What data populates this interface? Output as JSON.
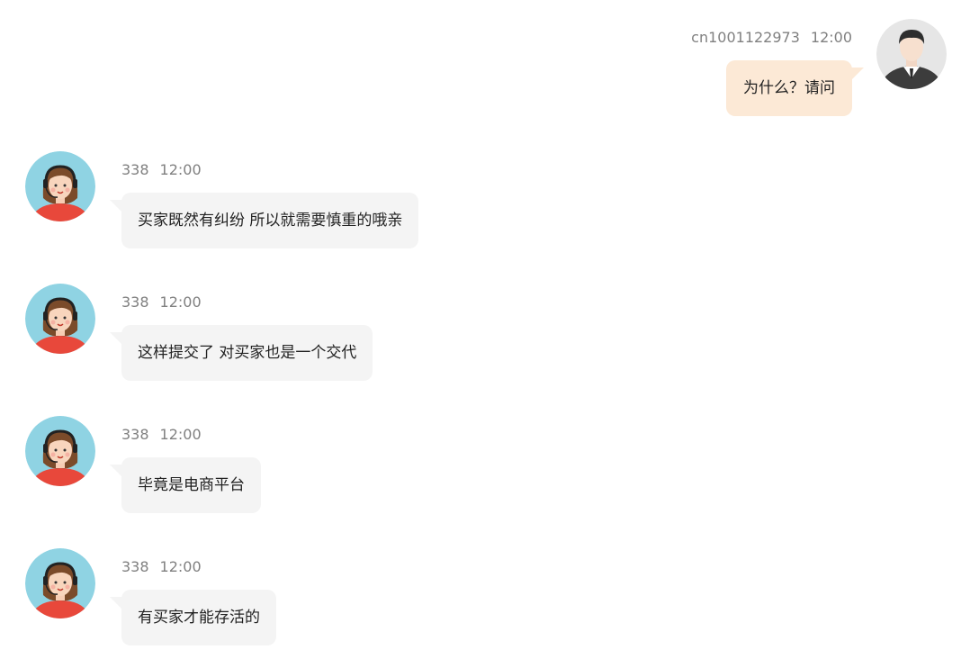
{
  "conversation": {
    "outgoing": {
      "sender": "cn1001122973",
      "time": "12:00",
      "text": "为什么？请问",
      "avatar_icon": "businessman-avatar-icon"
    },
    "incoming": [
      {
        "sender": "338",
        "time": "12:00",
        "text": "买家既然有纠纷 所以就需要慎重的哦亲",
        "avatar_icon": "agent-headset-avatar-icon"
      },
      {
        "sender": "338",
        "time": "12:00",
        "text": "这样提交了 对买家也是一个交代",
        "avatar_icon": "agent-headset-avatar-icon"
      },
      {
        "sender": "338",
        "time": "12:00",
        "text": "毕竟是电商平台",
        "avatar_icon": "agent-headset-avatar-icon"
      },
      {
        "sender": "338",
        "time": "12:00",
        "text": "有买家才能存活的",
        "avatar_icon": "agent-headset-avatar-icon"
      }
    ]
  },
  "colors": {
    "outgoing_bubble": "#fce9d6",
    "incoming_bubble": "#f4f4f4",
    "agent_avatar_bg": "#8fd3e3",
    "agent_shirt": "#e8483b",
    "meta_text": "#808080"
  }
}
